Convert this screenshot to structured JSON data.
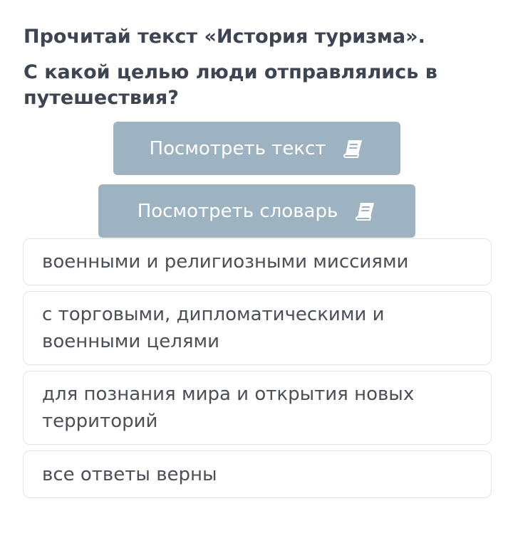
{
  "question": {
    "title": "Прочитай текст «История туризма».",
    "text": "С какой целью люди отправлялись в путешествия?"
  },
  "buttons": {
    "view_text": {
      "label": "Посмотреть текст",
      "icon": "book-icon"
    },
    "view_vocabulary": {
      "label": "Посмотреть словарь",
      "icon": "book-icon"
    }
  },
  "answers": [
    {
      "label": "военными и религиозными миссиями"
    },
    {
      "label": "с торговыми, дипломатическими и военными целями"
    },
    {
      "label": "для познания мира и открытия новых территорий"
    },
    {
      "label": "все ответы верны"
    }
  ],
  "colors": {
    "button_bg": "#9eb3c1",
    "heading_text": "#3d4552",
    "answer_text": "#4a4f58",
    "answer_border": "#e1e4e8"
  }
}
